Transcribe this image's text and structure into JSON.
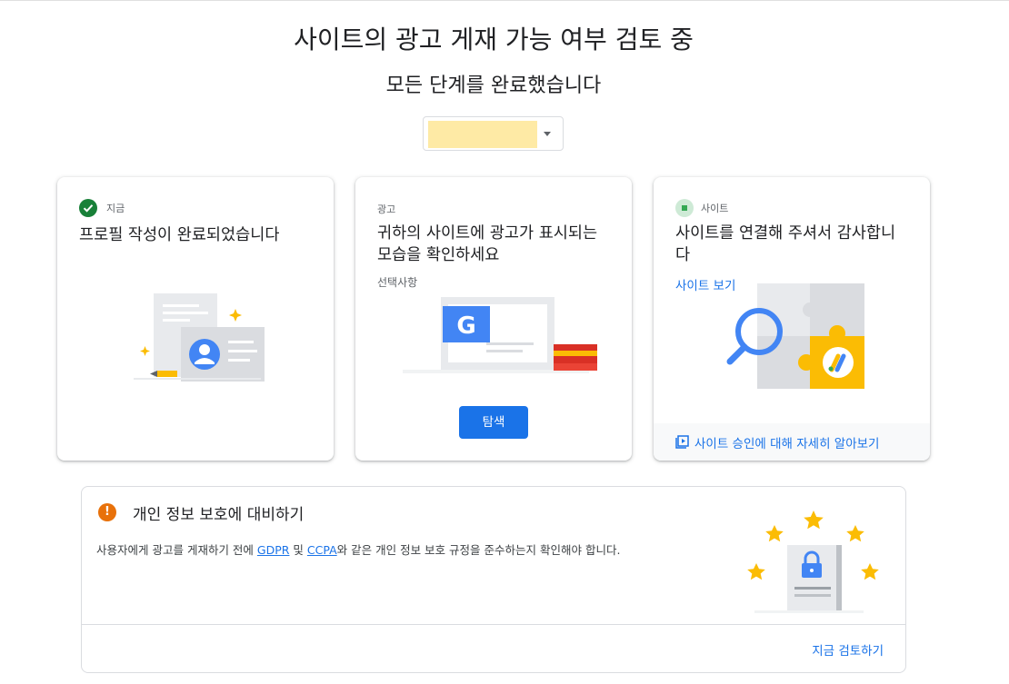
{
  "header": {
    "title": "사이트의 광고 게재 가능 여부 검토 중",
    "subtitle": "모든 단계를 완료했습니다"
  },
  "site_selector": {
    "value": "",
    "highlight_color": "#feeaa5"
  },
  "cards": [
    {
      "status_icon": "check-circle-icon",
      "status_label": "지금",
      "heading": "프로필 작성이 완료되었습니다",
      "illustration": "profile-card-illustration"
    },
    {
      "status_label": "광고",
      "heading": "귀하의 사이트에 광고가 표시되는 모습을 확인하세요",
      "optional_label": "선택사항",
      "illustration": "google-ads-preview-illustration",
      "button_label": "탐색",
      "illustration_letter": "G"
    },
    {
      "status_icon": "site-dot-icon",
      "status_label": "사이트",
      "heading": "사이트를 연결해 주셔서 감사합니다",
      "link_label": "사이트 보기",
      "illustration": "puzzle-magnifier-illustration",
      "footer_icon": "video-library-icon",
      "footer_label": "사이트 승인에 대해 자세히 알아보기"
    }
  ],
  "privacy": {
    "warning_icon": "warning-circle-icon",
    "warning_symbol": "!",
    "title": "개인 정보 보호에 대비하기",
    "text_before": "사용자에게 광고를 게재하기 전에 ",
    "gdpr": "GDPR",
    "text_mid": " 및 ",
    "ccpa": "CCPA",
    "text_after": "와 같은 개인 정보 보호 규정을 준수하는지 확인해야 합니다.",
    "illustration": "locked-document-stars-illustration",
    "action_label": "지금 검토하기"
  },
  "colors": {
    "primary": "#1a73e8",
    "success": "#188038",
    "warning": "#e8710a",
    "star": "#fbbc04"
  }
}
